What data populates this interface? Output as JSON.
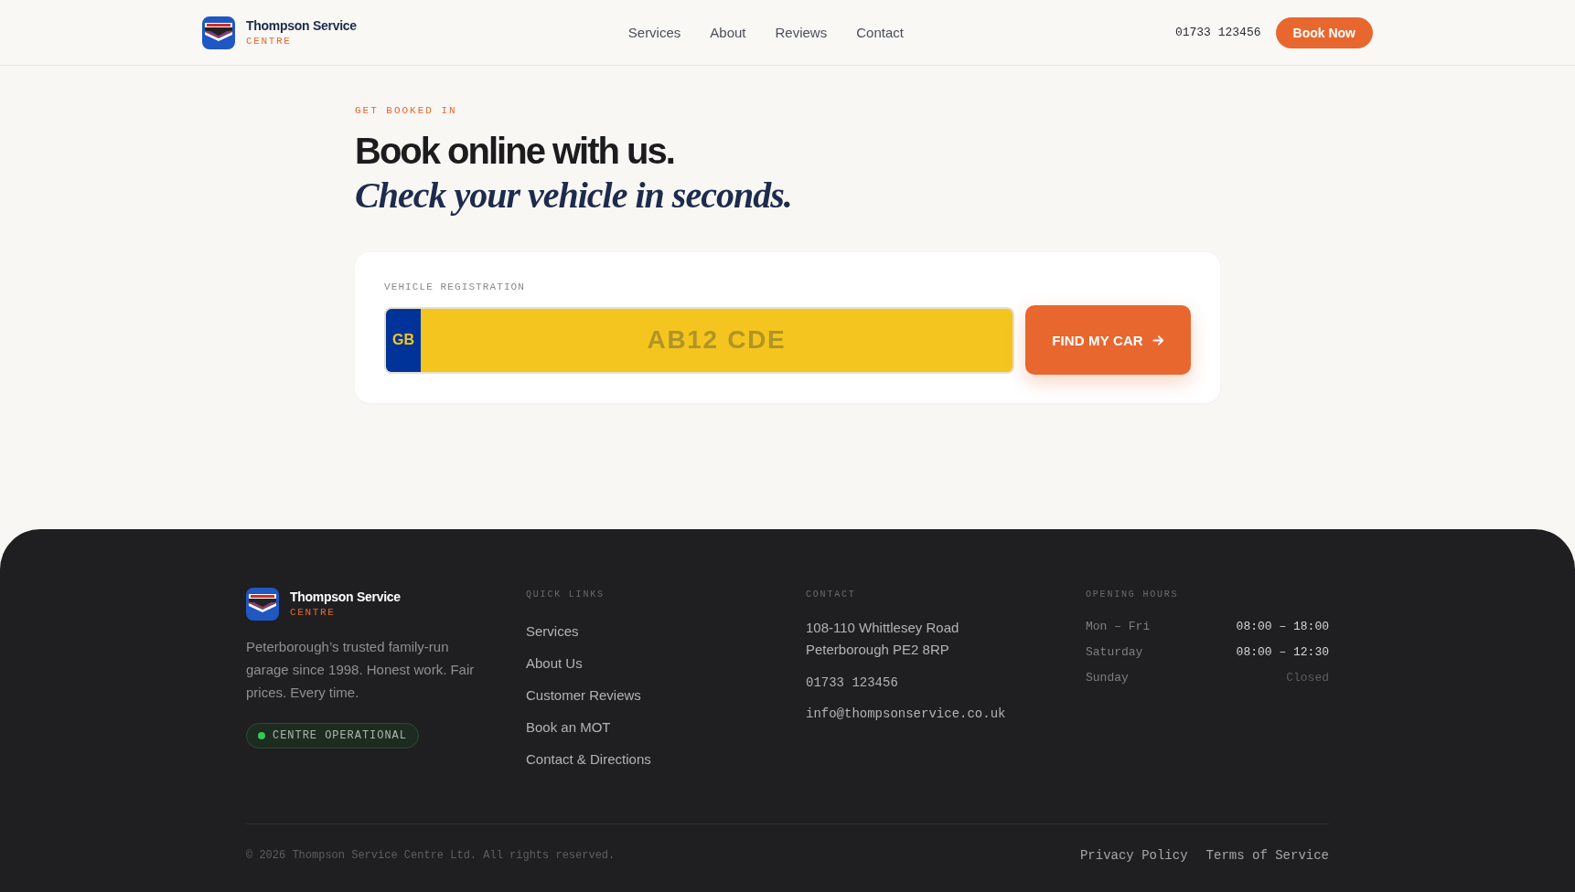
{
  "header": {
    "brand": {
      "name": "Thompson Service",
      "tagline": "CENTRE"
    },
    "nav": [
      {
        "label": "Services"
      },
      {
        "label": "About"
      },
      {
        "label": "Reviews"
      },
      {
        "label": "Contact"
      }
    ],
    "phone": "01733 123456",
    "cta": "Book Now"
  },
  "hero": {
    "eyebrow": "GET BOOKED IN",
    "title": "Book online with us.",
    "subtitle": "Check your vehicle in seconds."
  },
  "lookup": {
    "label": "VEHICLE REGISTRATION",
    "country": "GB",
    "placeholder": "AB12 CDE",
    "button": "FIND MY CAR"
  },
  "footer": {
    "brand": {
      "name": "Thompson Service",
      "tagline": "CENTRE"
    },
    "description": "Peterborough’s trusted family-run garage since 1998. Honest work. Fair prices. Every time.",
    "status": "CENTRE OPERATIONAL",
    "quick_links": {
      "heading": "QUICK LINKS",
      "links": [
        "Services",
        "About Us",
        "Customer Reviews",
        "Book an MOT",
        "Contact & Directions"
      ]
    },
    "contact": {
      "heading": "CONTACT",
      "address": [
        "108-110 Whittlesey Road",
        "Peterborough PE2 8RP"
      ],
      "phone": "01733 123456",
      "email": "info@thompsonservice.co.uk"
    },
    "hours": {
      "heading": "OPENING HOURS",
      "rows": [
        {
          "day": "Mon – Fri",
          "time": "08:00 – 18:00",
          "closed": false
        },
        {
          "day": "Saturday",
          "time": "08:00 – 12:30",
          "closed": false
        },
        {
          "day": "Sunday",
          "time": "Closed",
          "closed": true
        }
      ]
    },
    "copyright": "© 2026 Thompson Service Centre Ltd. All rights reserved.",
    "legal_links": [
      "Privacy Policy",
      "Terms of Service"
    ]
  }
}
